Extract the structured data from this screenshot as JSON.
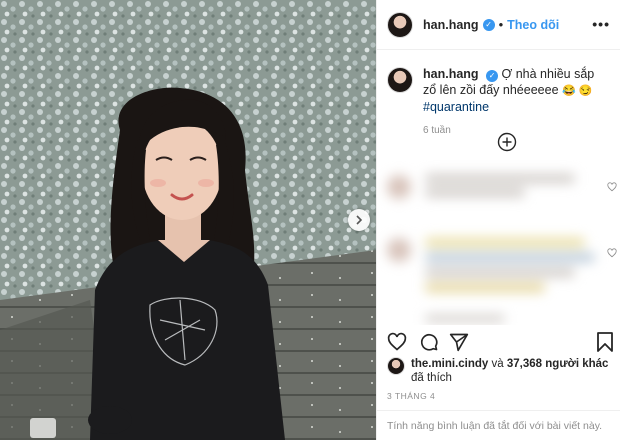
{
  "post": {
    "username": "han.hang",
    "follow_label": "Theo dõi",
    "more_label": "•••",
    "caption_text": "Ợ nhà nhiều sắp zổ lên zồi đấy nhéeeeee",
    "caption_emoji": "😂 😏",
    "hashtag": "#quarantine",
    "time_ago": "6 tuần",
    "liked_by_user": "the.mini.cindy",
    "likes_mid": "và",
    "likes_count": "37,368",
    "likes_suffix": "người khác",
    "likes_line2": "đã thích",
    "date": "3 THÁNG 4",
    "comments_disabled": "Tính năng bình luận đã tắt đối với bài viết này."
  },
  "colors": {
    "link_blue": "#3897f0",
    "hashtag_blue": "#00376b",
    "muted_gray": "#8e8e8e",
    "border": "#efefef"
  },
  "icons": [
    "verified-icon",
    "more-options-icon",
    "add-comment-icon",
    "heart-icon",
    "comment-icon",
    "share-icon",
    "bookmark-icon",
    "next-arrow-icon"
  ]
}
